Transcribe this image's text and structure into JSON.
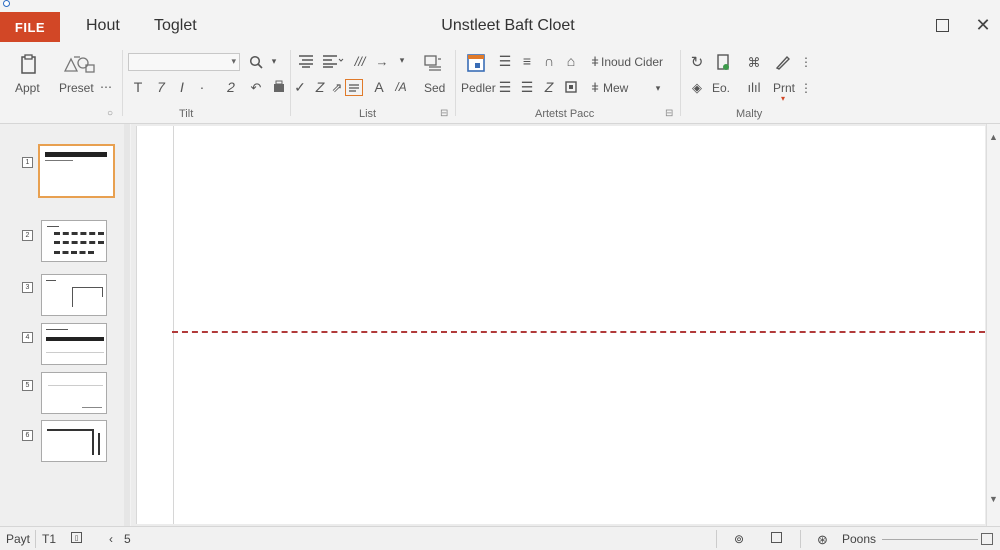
{
  "titlebar": {
    "file_tab": "FILE",
    "tabs": [
      "Hout",
      "Toglet"
    ],
    "document_title": "Unstleet Baft Cloet"
  },
  "ribbon": {
    "apply_label": "Appt",
    "preset_label": "Preset",
    "sed_label": "Sed",
    "pedler_label": "Pedler",
    "insert_cider_label": "Inoud Cider",
    "mew_label": "Mew",
    "eo_label": "Eo.",
    "prnt_label": "Prnt",
    "text_row": [
      "T",
      "7",
      "I",
      "·",
      "2"
    ],
    "groups": {
      "tilt": "Tilt",
      "list": "List",
      "artest_pacc": "Artetst Pacc",
      "malty": "Malty"
    }
  },
  "slides": [
    {
      "num": "1",
      "active": true
    },
    {
      "num": "2",
      "active": false
    },
    {
      "num": "3",
      "active": false
    },
    {
      "num": "4",
      "active": false
    },
    {
      "num": "5",
      "active": false
    },
    {
      "num": "6",
      "active": false
    }
  ],
  "statusbar": {
    "page_label": "Payt",
    "t1_label": "T1",
    "page_num": "5",
    "zoom_label": "Poons"
  },
  "colors": {
    "accent": "#d24726",
    "guide": "#b13a3a",
    "thumb_active": "#e8a050"
  }
}
